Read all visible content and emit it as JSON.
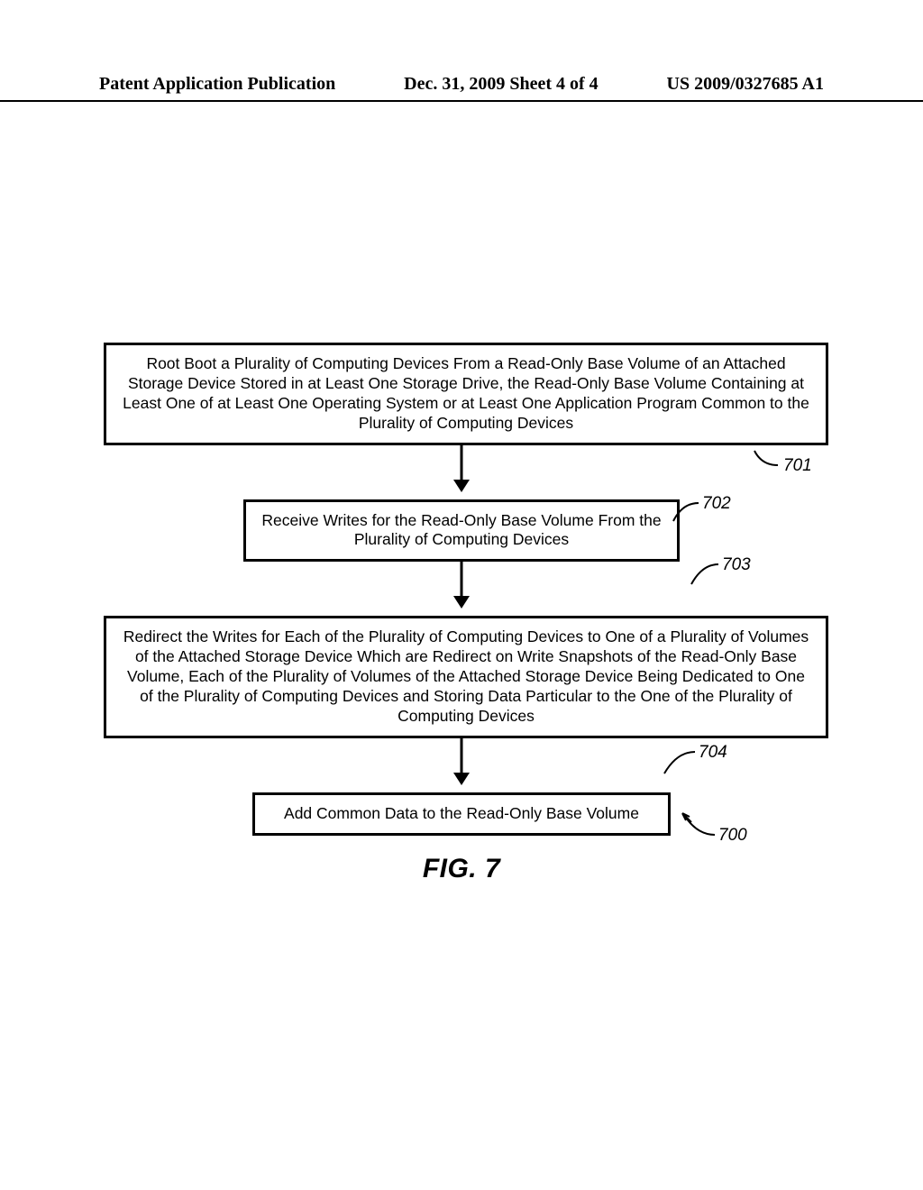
{
  "header": {
    "left": "Patent Application Publication",
    "center": "Dec. 31, 2009  Sheet 4 of 4",
    "right": "US 2009/0327685 A1"
  },
  "boxes": {
    "step1": "Root Boot a Plurality of Computing Devices From a Read-Only Base Volume of an Attached Storage Device Stored in at Least One Storage Drive, the Read-Only Base Volume Containing at Least One of at Least One Operating System or at Least One Application Program Common to the Plurality of Computing Devices",
    "step2": "Receive Writes for the Read-Only Base Volume From the Plurality of Computing Devices",
    "step3": "Redirect the Writes for Each of the Plurality of Computing Devices to One of a Plurality of Volumes of the Attached Storage Device Which are Redirect on Write Snapshots of the Read-Only Base Volume, Each of the Plurality of Volumes of the Attached Storage Device Being Dedicated to One of the Plurality of Computing Devices and Storing Data Particular to the One of the Plurality of Computing Devices",
    "step4": "Add Common Data to the Read-Only Base Volume"
  },
  "labels": {
    "l701": "701",
    "l702": "702",
    "l703": "703",
    "l704": "704",
    "l700": "700"
  },
  "figure_caption": "FIG. 7"
}
